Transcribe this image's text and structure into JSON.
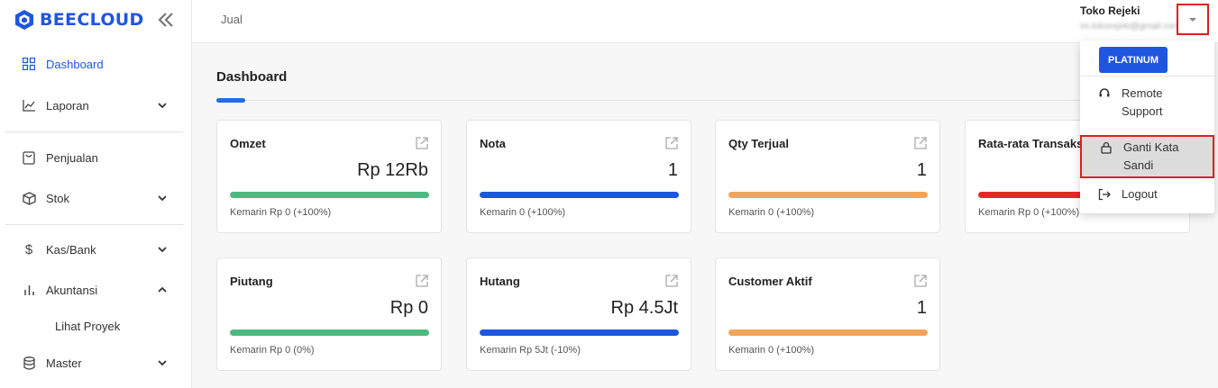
{
  "brand": {
    "name": "BEECLOUD",
    "color": "#1f56e0"
  },
  "icons": {
    "collapse": "double-chevron-left-icon",
    "dashboard": "grid-icon",
    "laporan": "line-chart-icon",
    "penjualan": "receipt-icon",
    "stok": "box-icon",
    "kas": "dollar-icon",
    "akuntansi": "bar-chart-icon",
    "master": "database-icon",
    "external": "external-link-icon",
    "support": "headset-icon",
    "password": "lock-icon",
    "logout": "logout-icon"
  },
  "sidebar": {
    "items": [
      {
        "label": "Dashboard",
        "active": true
      },
      {
        "label": "Laporan",
        "expandable": true
      },
      {
        "label": "Penjualan"
      },
      {
        "label": "Stok",
        "expandable": true
      },
      {
        "label": "Kas/Bank",
        "expandable": true
      },
      {
        "label": "Akuntansi",
        "expandable": true,
        "expanded": true
      },
      {
        "label": "Lihat Proyek",
        "sub": true
      },
      {
        "label": "Master",
        "expandable": true
      }
    ]
  },
  "topbar": {
    "breadcrumb": "Jual"
  },
  "main": {
    "title": "Dashboard"
  },
  "cards": [
    {
      "title": "Omzet",
      "value": "Rp 12Rb",
      "sub": "Kemarin Rp 0 (+100%)",
      "color": "#4cba7f"
    },
    {
      "title": "Nota",
      "value": "1",
      "sub": "Kemarin 0 (+100%)",
      "color": "#1f56e0"
    },
    {
      "title": "Qty Terjual",
      "value": "1",
      "sub": "Kemarin 0 (+100%)",
      "color": "#f0a55a"
    },
    {
      "title": "Rata-rata Transaksi",
      "value": "",
      "sub": "Kemarin Rp 0 (+100%)",
      "color": "#e02b2b"
    },
    {
      "title": "Piutang",
      "value": "Rp 0",
      "sub": "Kemarin Rp 0 (0%)",
      "color": "#4cba7f"
    },
    {
      "title": "Hutang",
      "value": "Rp 4.5Jt",
      "sub": "Kemarin Rp 5Jt (-10%)",
      "color": "#1f56e0"
    },
    {
      "title": "Customer Aktif",
      "value": "1",
      "sub": "Kemarin 0 (+100%)",
      "color": "#f0a55a"
    }
  ],
  "user": {
    "store": "Toko Rejeki",
    "email": "ini.tokorejeki@gmail.com"
  },
  "dropdown": {
    "plan": "PLATINUM",
    "items": [
      {
        "label": "Remote Support"
      },
      {
        "label": "Ganti Kata Sandi",
        "highlighted": true
      },
      {
        "label": "Logout"
      }
    ]
  },
  "colors": {
    "accent": "#1f56e0",
    "highlight_border": "#e01e1e"
  }
}
